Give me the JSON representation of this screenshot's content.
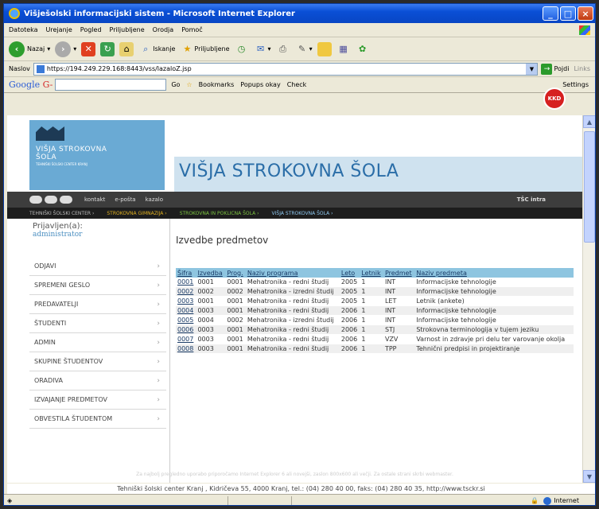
{
  "window": {
    "title": "Višješolski informacijski sistem - Microsoft Internet Explorer"
  },
  "menubar": [
    "Datoteka",
    "Urejanje",
    "Pogled",
    "Priljubljene",
    "Orodja",
    "Pomoč"
  ],
  "toolbar": {
    "back": "Nazaj",
    "search": "Iskanje",
    "favorites": "Priljubljene"
  },
  "addressbar": {
    "label": "Naslov",
    "url": "https://194.249.229.168:8443/vss/lazaloZ.jsp",
    "go": "Pojdi",
    "links": "Links"
  },
  "googlebar": {
    "logo_g": "Google",
    "logo_g2": "G-",
    "go": "Go",
    "bookmarks": "Bookmarks",
    "popups": "Popups okay",
    "check": "Check",
    "settings": "Settings"
  },
  "site": {
    "logo_line1": "VIŠJA STROKOVNA",
    "logo_line2": "ŠOLA",
    "logo_small": "TEHNIŠKI ŠOLSKI CENTER KRANJ",
    "title": "VIŠJA STROKOVNA ŠOLA"
  },
  "nav1": {
    "links": [
      "kontakt",
      "e-pošta",
      "kazalo"
    ],
    "tsc": "TŠC intra",
    "badge": "KKD"
  },
  "nav2": [
    {
      "label": "TEHNIŠKI ŠOLSKI CENTER ›",
      "color": "#bbbbbb"
    },
    {
      "label": "STROKOVNA GIMNAZIJA ›",
      "color": "#e0b020"
    },
    {
      "label": "STROKOVNA IN POKLICNA ŠOLA ›",
      "color": "#7cc340"
    },
    {
      "label": "VIŠJA STROKOVNA ŠOLA ›",
      "color": "#8ec8f0"
    }
  ],
  "login": {
    "label": "Prijavljen(a):",
    "user": "administrator"
  },
  "sidemenu": [
    "ODJAVI",
    "SPREMENI GESLO",
    "PREDAVATELJI",
    "ŠTUDENTI",
    "ADMIN",
    "SKUPINE ŠTUDENTOV",
    "ORADIVA",
    "IZVAJANJE PREDMETOV",
    "OBVESTILA ŠTUDENTOM"
  ],
  "main": {
    "title": "Izvedbe predmetov",
    "columns": [
      "Šifra",
      "Izvedba",
      "Prog.",
      "Naziv programa",
      "Leto",
      "Letnik",
      "Predmet",
      "Naziv predmeta"
    ],
    "rows": [
      [
        "0001",
        "0001",
        "0001",
        "Mehatronika - redni študij",
        "2005",
        "1",
        "INT",
        "Informacijske tehnologije"
      ],
      [
        "0002",
        "0002",
        "0002",
        "Mehatronika - izredni študij",
        "2005",
        "1",
        "INT",
        "Informacijske tehnologije"
      ],
      [
        "0003",
        "0001",
        "0001",
        "Mehatronika - redni študij",
        "2005",
        "1",
        "LET",
        "Letnik (ankete)"
      ],
      [
        "0004",
        "0003",
        "0001",
        "Mehatronika - redni študij",
        "2006",
        "1",
        "INT",
        "Informacijske tehnologije"
      ],
      [
        "0005",
        "0004",
        "0002",
        "Mehatronika - izredni študij",
        "2006",
        "1",
        "INT",
        "Informacijske tehnologije"
      ],
      [
        "0006",
        "0003",
        "0001",
        "Mehatronika - redni študij",
        "2006",
        "1",
        "STJ",
        "Strokovna terminologija v tujem jeziku"
      ],
      [
        "0007",
        "0003",
        "0001",
        "Mehatronika - redni študij",
        "2006",
        "1",
        "VZV",
        "Varnost in zdravje pri delu ter varovanje okolja"
      ],
      [
        "0008",
        "0003",
        "0001",
        "Mehatronika - redni študij",
        "2006",
        "1",
        "TPP",
        "Tehnični predpisi in projektiranje"
      ]
    ]
  },
  "footnote": "Za najbolj pregledno uporabo priporočamo Internet Explorer 6 ali novejši, zaslon 800x600 ali večji. Za ostale strani skrbi webmaster.",
  "footer": "Tehniški šolski center Kranj , Kidričeva 55, 4000 Kranj, tel.: (04) 280 40 00, faks: (04) 280 40 35, http://www.tsckr.si",
  "status": {
    "zone": "Internet"
  }
}
